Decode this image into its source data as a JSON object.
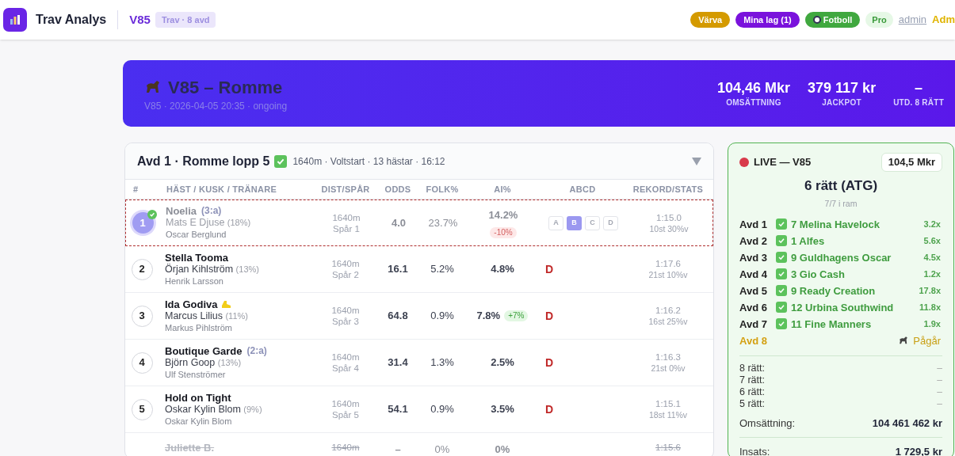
{
  "app": {
    "title": "Trav Analys",
    "game": "V85",
    "game_tag": "Trav · 8 avd"
  },
  "nav": [
    {
      "kind": "pill",
      "label": "Värva",
      "color": "#d49a00"
    },
    {
      "kind": "pill",
      "label": "Mina lag (1)",
      "color": "#7a12dc"
    },
    {
      "kind": "pill",
      "label": "Fotboll",
      "color": "#40a83f",
      "icon": true
    },
    {
      "kind": "soft",
      "label": "Pro"
    },
    {
      "kind": "link",
      "label": "admin"
    },
    {
      "kind": "warn",
      "label": "Adm"
    }
  ],
  "hero": {
    "title": "V85 – Romme",
    "subtitle": "V85 · 2026-04-05 20:35 · ongoing",
    "stats": [
      {
        "value": "104,46 Mkr",
        "label": "OMSÄTTNING"
      },
      {
        "value": "379 117 kr",
        "label": "JACKPOT"
      },
      {
        "value": "–",
        "label": "UTD. 8 RÄTT"
      }
    ]
  },
  "race": {
    "title": "Avd 1 · Romme lopp 5",
    "done": true,
    "meta": "1640m · Voltstart · 13 hästar · 16:12",
    "expanded": true,
    "columns": [
      "#",
      "HÄST / KUSK / TRÄNARE",
      "DIST/SPÅR",
      "ODDS",
      "FOLK%",
      "AI%",
      "ABCD",
      "REKORD/STATS"
    ],
    "rows": [
      {
        "number": "1",
        "name": "Noelia",
        "age": "(3:a)",
        "driver": "Mats E Djuse",
        "driver_pct": "(18%)",
        "trainer": "Oscar Berglund",
        "dist": "1640m",
        "track": "Spår 1",
        "odds": "4.0",
        "folk": "23.7%",
        "ai": "14.2%",
        "ai_change": {
          "text": "-10%",
          "up": false
        },
        "abcd": {
          "kind": "buttons",
          "options": [
            {
              "label": "A",
              "selected": false
            },
            {
              "label": "B",
              "selected": true
            },
            {
              "label": "C",
              "selected": false
            },
            {
              "label": "D",
              "selected": false
            }
          ]
        },
        "record": "1:15.0",
        "stats": "10st 30%v",
        "selected": true,
        "winner": true,
        "scratched": false,
        "flag": false
      },
      {
        "number": "2",
        "name": "Stella Tooma",
        "driver": "Örjan Kihlström",
        "driver_pct": "(13%)",
        "trainer": "Henrik Larsson",
        "dist": "1640m",
        "track": "Spår 2",
        "odds": "16.1",
        "folk": "5.2%",
        "ai": "4.8%",
        "abcd": {
          "kind": "letter",
          "label": "D"
        },
        "record": "1:17.6",
        "stats": "21st 10%v",
        "selected": false,
        "winner": false,
        "scratched": false,
        "flag": false
      },
      {
        "number": "3",
        "name": "Ida Godiva",
        "driver": "Marcus Lilius",
        "driver_pct": "(11%)",
        "trainer": "Markus Pihlström",
        "dist": "1640m",
        "track": "Spår 3",
        "odds": "64.8",
        "folk": "0.9%",
        "ai": "7.8%",
        "ai_change": {
          "text": "+7%",
          "up": true
        },
        "abcd": {
          "kind": "letter",
          "label": "D"
        },
        "record": "1:16.2",
        "stats": "16st 25%v",
        "selected": false,
        "winner": false,
        "scratched": false,
        "flag": true
      },
      {
        "number": "4",
        "name": "Boutique Garde",
        "age": "(2:a)",
        "driver": "Björn Goop",
        "driver_pct": "(13%)",
        "trainer": "Ulf Stenströmer",
        "dist": "1640m",
        "track": "Spår 4",
        "odds": "31.4",
        "folk": "1.3%",
        "ai": "2.5%",
        "abcd": {
          "kind": "letter",
          "label": "D"
        },
        "record": "1:16.3",
        "stats": "21st 0%v",
        "selected": false,
        "winner": false,
        "scratched": false,
        "flag": false
      },
      {
        "number": "5",
        "name": "Hold on Tight",
        "driver": "Oskar Kylin Blom",
        "driver_pct": "(9%)",
        "trainer": "Oskar Kylin Blom",
        "dist": "1640m",
        "track": "Spår 5",
        "odds": "54.1",
        "folk": "0.9%",
        "ai": "3.5%",
        "abcd": {
          "kind": "letter",
          "label": "D"
        },
        "record": "1:15.1",
        "stats": "18st 11%v",
        "selected": false,
        "winner": false,
        "scratched": false,
        "flag": false
      },
      {
        "name": "Juliette B.",
        "dist": "1640m",
        "odds": "–",
        "folk": "0%",
        "ai": "0%",
        "record": "1:15.6",
        "selected": false,
        "winner": false,
        "scratched": true,
        "flag": false
      }
    ]
  },
  "live": {
    "title": "LIVE — V85",
    "amount": "104,5 Mkr",
    "result": "6 rätt (ATG)",
    "sub": "7/7 i ram",
    "legs": [
      {
        "label": "Avd 1",
        "done": true,
        "horse": "7 Melina Havelock",
        "odds": "3.2x"
      },
      {
        "label": "Avd 2",
        "done": true,
        "horse": "1 Alfes",
        "odds": "5.6x"
      },
      {
        "label": "Avd 3",
        "done": true,
        "horse": "9 Guldhagens Oscar",
        "odds": "4.5x"
      },
      {
        "label": "Avd 4",
        "done": true,
        "horse": "3 Gio Cash",
        "odds": "1.2x"
      },
      {
        "label": "Avd 5",
        "done": true,
        "horse": "9 Ready Creation",
        "odds": "17.8x"
      },
      {
        "label": "Avd 6",
        "done": true,
        "horse": "12 Urbina Southwind",
        "odds": "11.8x"
      },
      {
        "label": "Avd 7",
        "done": true,
        "horse": "11 Fine Manners",
        "odds": "1.9x"
      },
      {
        "label": "Avd 8",
        "done": false,
        "state_text": "Pågår"
      }
    ],
    "payouts": [
      {
        "label": "8 rätt:",
        "value": "–"
      },
      {
        "label": "7 rätt:",
        "value": "–"
      },
      {
        "label": "6 rätt:",
        "value": "–"
      },
      {
        "label": "5 rätt:",
        "value": "–"
      }
    ],
    "turnover": {
      "label": "Omsättning:",
      "value": "104 461 462 kr"
    },
    "stake": {
      "label": "Insats:",
      "value": "1 729,5 kr"
    }
  }
}
